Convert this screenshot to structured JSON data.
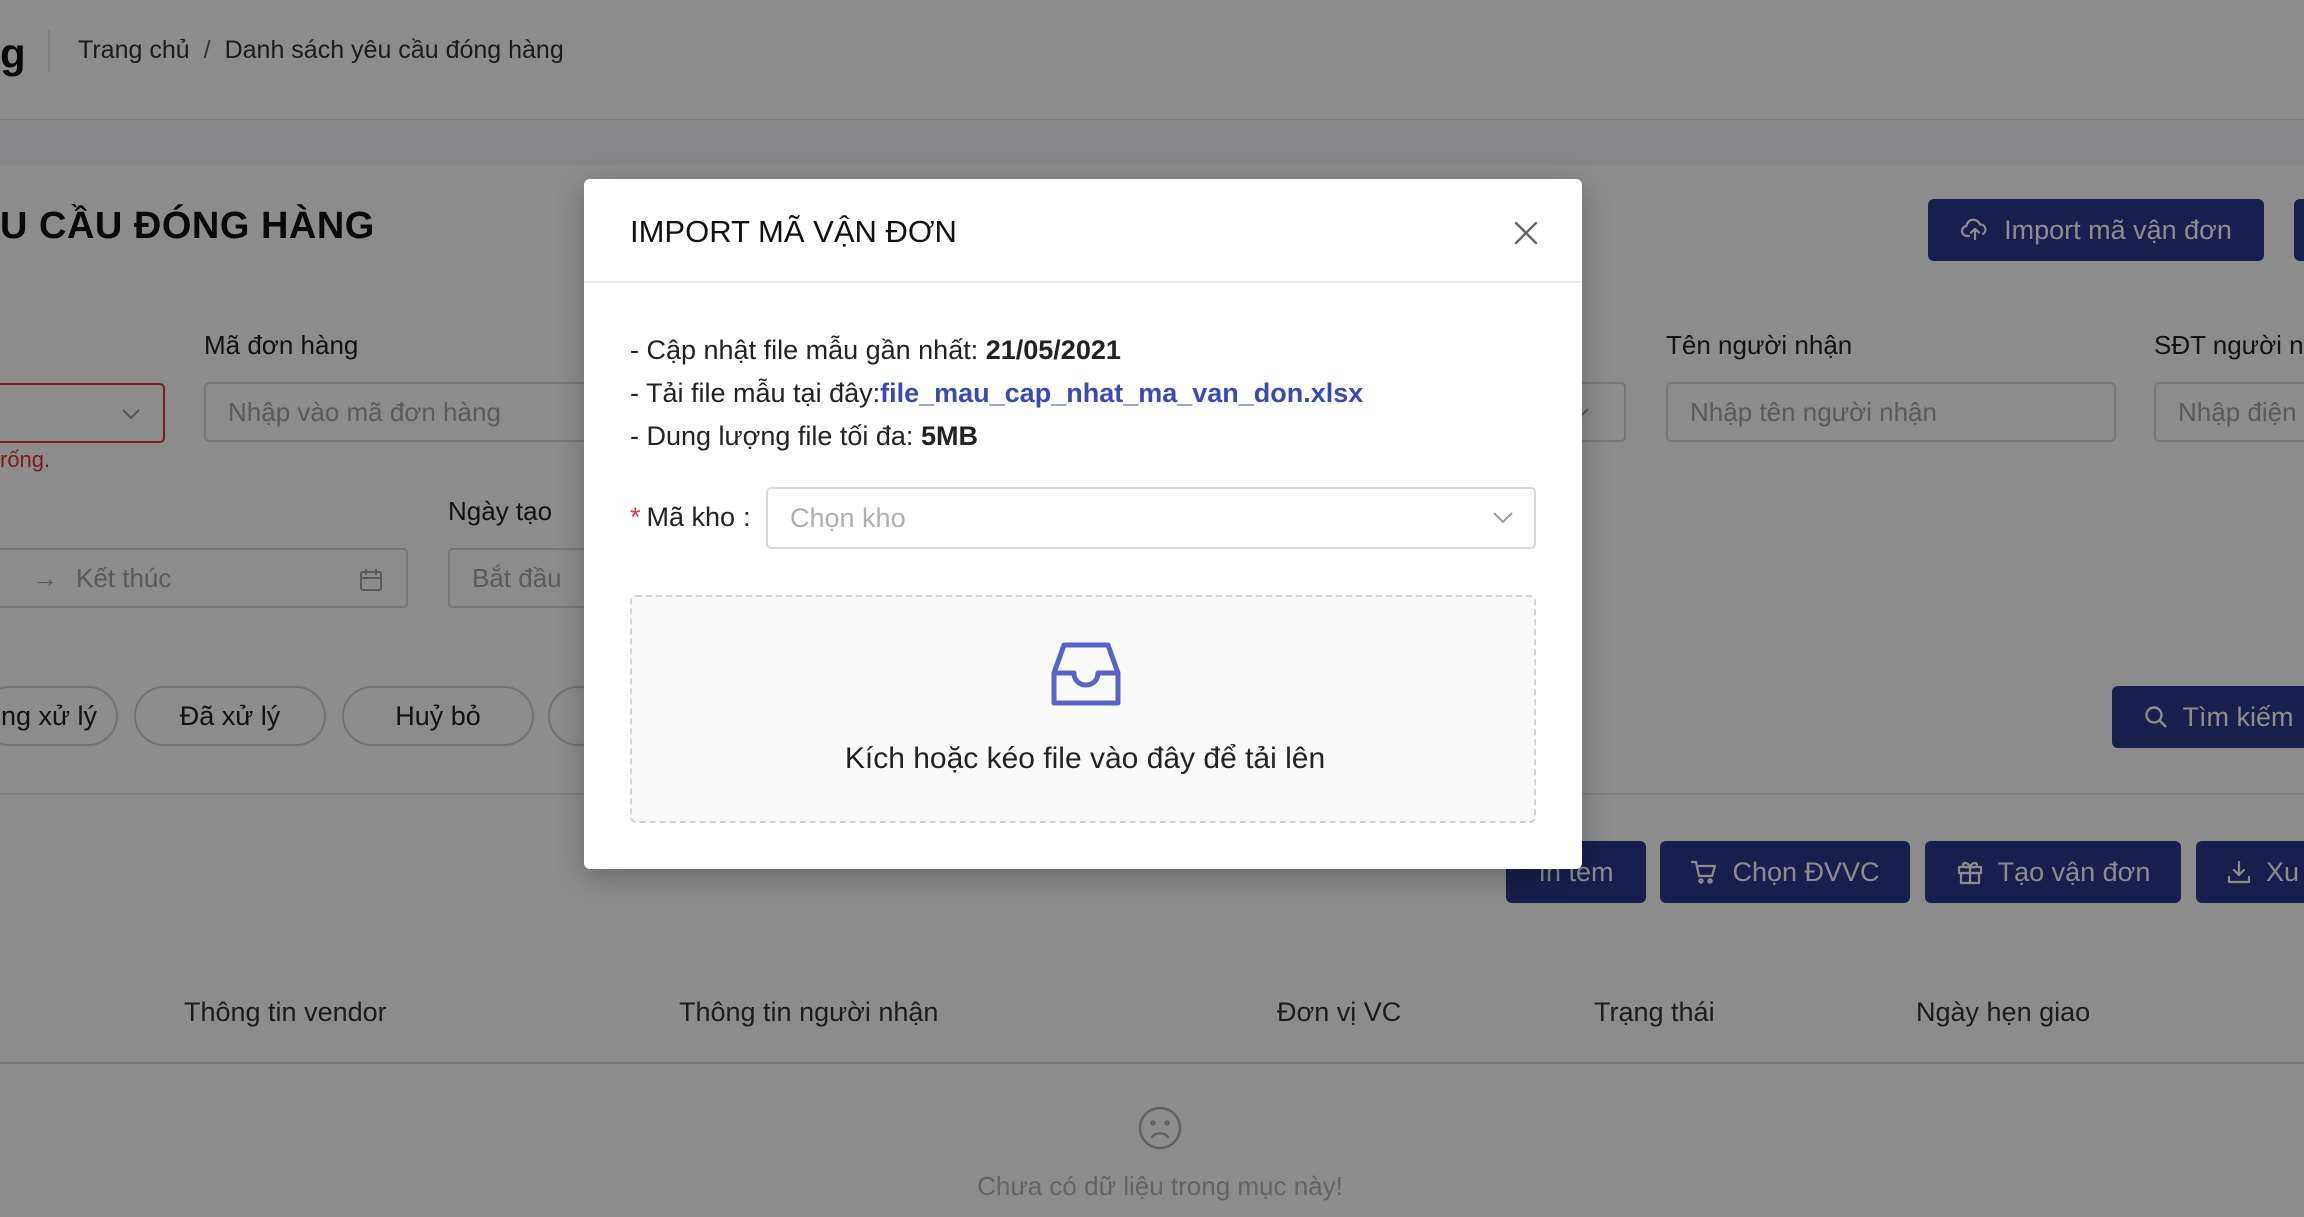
{
  "header": {
    "brand_fragment": "g",
    "breadcrumb": {
      "home": "Trang chủ",
      "separator": "/",
      "current": "Danh sách yêu cầu đóng hàng"
    }
  },
  "page": {
    "title": "U CẦU ĐÓNG HÀNG",
    "import_button": "Import mã vận đơn"
  },
  "filters": {
    "order_code": {
      "label": "Mã đơn hàng",
      "placeholder": "Nhập vào mã đơn hàng"
    },
    "receiver_name": {
      "label": "Tên người nhận",
      "placeholder": "Nhập tên người nhận"
    },
    "receiver_phone": {
      "label": "SĐT người n",
      "placeholder": "Nhập điện"
    },
    "error_text": "rống.",
    "end_date_placeholder": "Kết thúc",
    "created_date": {
      "label": "Ngày tạo",
      "placeholder": "Bắt đầu"
    }
  },
  "status_pills": [
    "ng xử lý",
    "Đã xử lý",
    "Huỷ bỏ"
  ],
  "search_button": "Tìm kiếm",
  "actions": {
    "print_label": "In tem",
    "choose_carrier": "Chọn ĐVVC",
    "create_waybill": "Tạo vận đơn",
    "export": "Xu"
  },
  "table": {
    "columns": [
      "Thông tin vendor",
      "Thông tin người nhận",
      "Đơn vị VC",
      "Trạng thái",
      "Ngày hẹn giao"
    ],
    "empty_text": "Chưa có dữ liệu trong mục này!"
  },
  "modal": {
    "title": "IMPORT MÃ VẬN ĐƠN",
    "line1_prefix": "- Cập nhật file mẫu gần nhất: ",
    "line1_value": "21/05/2021",
    "line2_prefix": "- Tải file mẫu tại đây:",
    "line2_link": "file_mau_cap_nhat_ma_van_don.xlsx",
    "line3_prefix": "- Dung lượng file tối đa: ",
    "line3_value": "5MB",
    "warehouse_required": "*",
    "warehouse_label": "Mã kho",
    "warehouse_colon": ":",
    "warehouse_placeholder": "Chọn kho",
    "dropzone_text": "Kích hoặc kéo file vào đây để tải lên"
  },
  "colors": {
    "primary": "#2e3a8c",
    "link": "#3b49b8",
    "error": "#e0353a",
    "upload_icon": "#5664c9"
  }
}
